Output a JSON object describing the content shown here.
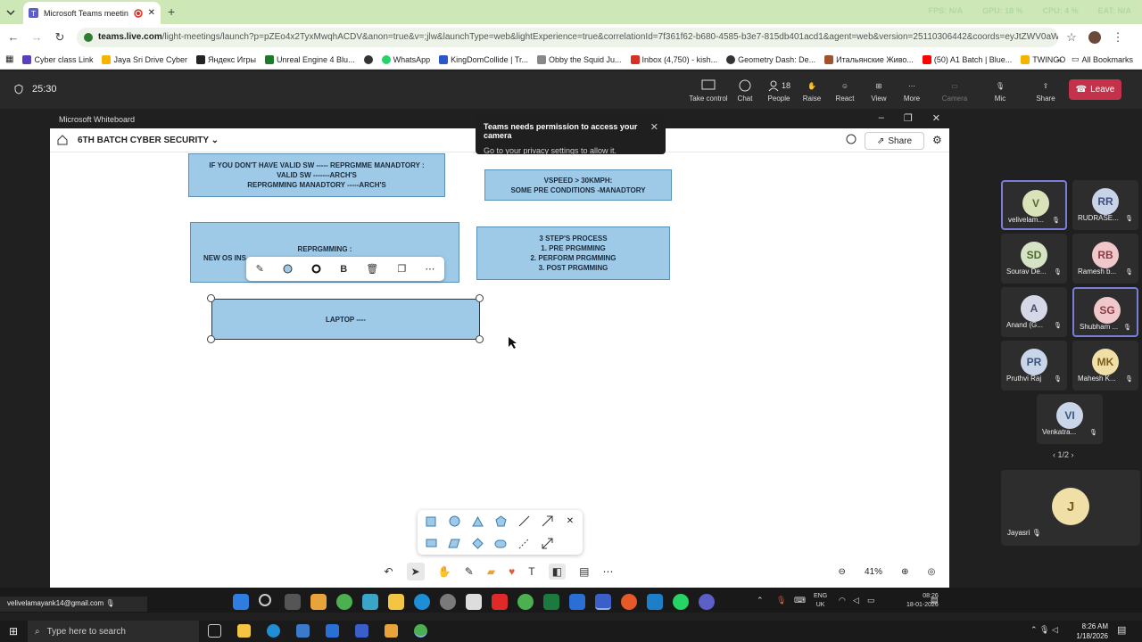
{
  "browser": {
    "tab_title": "Microsoft Teams meeting |",
    "new_tab": "+",
    "perf": [
      "FPS: N/A",
      "GPU: 18 %",
      "CPU: 4 %",
      "EAT: N/A"
    ],
    "url_host": "teams.live.com",
    "url_path": "/light-meetings/launch?p=pZEo4x2TyxMwqhACDV&anon=true&v=;jlw&launchType=web&lightExperience=true&correlationId=7f361f62-b680-4585-b3e7-815db401acd1&agent=web&version=25110306442&coords=eyJtZWV0aW5nVXJsIjoiaHR0c...",
    "bookmarks": [
      {
        "label": "Cyber class Link",
        "color": "#5a3fbf"
      },
      {
        "label": "Jaya Sri Drive Cyber",
        "color": "#f4b400"
      },
      {
        "label": "Яндекс Игры",
        "color": "#222222"
      },
      {
        "label": "Unreal Engine 4 Blu...",
        "color": "#1c7a2a"
      },
      {
        "label": "",
        "color": "#333333"
      },
      {
        "label": "WhatsApp",
        "color": "#25d366"
      },
      {
        "label": "KingDomCollide | Tr...",
        "color": "#2a57c9"
      },
      {
        "label": "Obby the Squid Ju...",
        "color": "#888888"
      },
      {
        "label": "Inbox (4,750) - kish...",
        "color": "#d93025"
      },
      {
        "label": "Geometry Dash: De...",
        "color": "#333333"
      },
      {
        "label": "Итальянские Живо...",
        "color": "#a0522d"
      },
      {
        "label": "(50) A1 Batch | Blue...",
        "color": "#ff0000"
      },
      {
        "label": "TWINGO",
        "color": "#f4b400"
      }
    ],
    "all_bookmarks": "All Bookmarks"
  },
  "teams": {
    "timer": "25:30",
    "controls": [
      {
        "label": "Take control",
        "icon": "take-control-icon"
      },
      {
        "label": "Chat",
        "icon": "chat-icon"
      },
      {
        "label": "People",
        "icon": "people-icon",
        "count": "18"
      },
      {
        "label": "Raise",
        "icon": "raise-hand-icon"
      },
      {
        "label": "React",
        "icon": "react-icon"
      },
      {
        "label": "View",
        "icon": "view-icon"
      },
      {
        "label": "More",
        "icon": "more-icon"
      },
      {
        "label": "Camera",
        "icon": "camera-icon"
      },
      {
        "label": "Mic",
        "icon": "mic-icon"
      },
      {
        "label": "Share",
        "icon": "share-icon"
      }
    ],
    "leave": "Leave"
  },
  "whiteboard": {
    "window_title": "Microsoft Whiteboard",
    "board_name": "6TH BATCH CYBER SECURITY",
    "share": "Share",
    "toast_title": "Teams needs permission to access your camera",
    "toast_body": "Go to your privacy settings to allow it.",
    "notes": [
      "IF YOU DON'T HAVE VALID SW ----- REPRGMME MANADTORY :\nVALID SW -------ARCH'S\nREPRGMMING MANADTORY -----ARCH'S",
      "VSPEED > 30KMPH:\nSOME PRE CONDITIONS -MANADTORY",
      "REPRGMMING :",
      "NEW OS INS",
      "3 STEP'S PROCESS\n1. PRE PRGMMING\n2. PERFORM PRGMMING\n3. POST PRGMMING",
      "LAPTOP ----"
    ],
    "zoom": "41%"
  },
  "participants": {
    "tiles": [
      {
        "initials": "V",
        "name": "velivelam...",
        "bg": "#d9e2b8"
      },
      {
        "initials": "RR",
        "name": "RUDRASE...",
        "bg": "#c9d3e8"
      },
      {
        "initials": "SD",
        "name": "Sourav De...",
        "bg": "#d6e3c4"
      },
      {
        "initials": "RB",
        "name": "Ramesh b...",
        "bg": "#f0c8cc"
      },
      {
        "initials": "A",
        "name": "Anand (G...",
        "bg": "#d5d8e6"
      },
      {
        "initials": "SG",
        "name": "Shubham ...",
        "bg": "#f0c8cc"
      },
      {
        "initials": "PR",
        "name": "Pruthvi Raj",
        "bg": "#c9d6ea"
      },
      {
        "initials": "MK",
        "name": "Mahesh K...",
        "bg": "#f1dfa8"
      },
      {
        "initials": "VI",
        "name": "Venkatra...",
        "bg": "#c9d6ea"
      }
    ],
    "pager": "1/2",
    "big_initials": "J",
    "big_name": "Jayasri"
  },
  "system": {
    "account": "velivelamayank14@gmail.com",
    "search_placeholder": "Type here to search",
    "lang_1": "ENG",
    "lang_2": "UK",
    "time_1": "08:26",
    "date_1": "18-01-2026",
    "time_2": "8:26 AM",
    "date_2": "1/18/2026"
  },
  "colors": {
    "accent": "#7a7fd6",
    "leave": "#c4314b",
    "note": "#9ecae8"
  }
}
